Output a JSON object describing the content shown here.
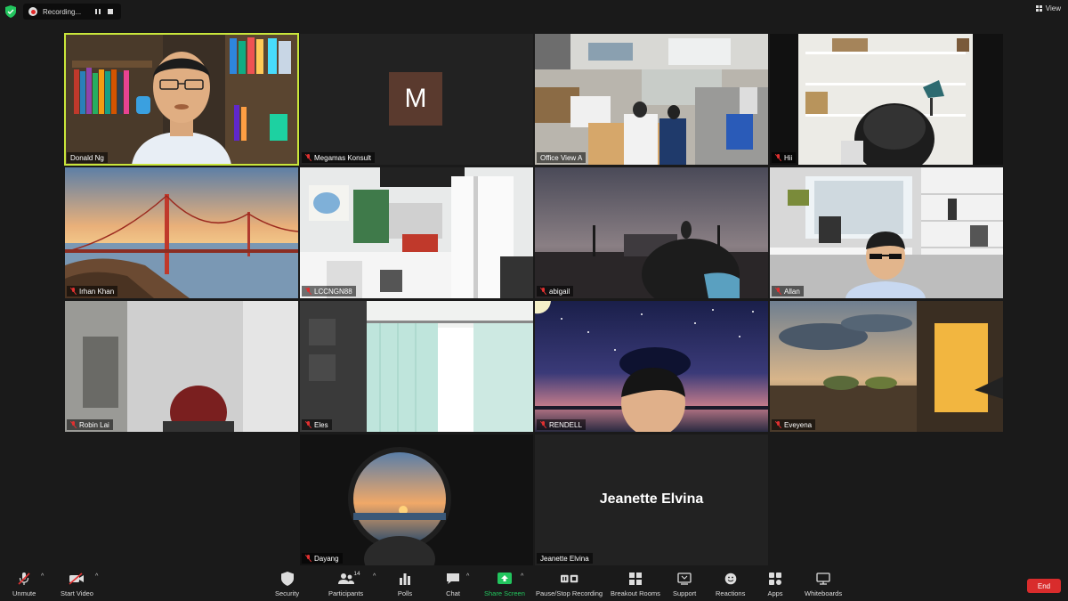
{
  "topbar": {
    "recording_label": "Recording...",
    "view_label": "View"
  },
  "tiles": [
    {
      "name": "Donald Ng",
      "muted": false,
      "active": true,
      "scene": "bookshelf-room"
    },
    {
      "name": "Megamas Konsult",
      "muted": true,
      "avatar_letter": "M",
      "scene": "avatar"
    },
    {
      "name": "Office View A",
      "muted": false,
      "scene": "office"
    },
    {
      "name": "Hii",
      "muted": true,
      "scene": "white-shelf-room"
    },
    {
      "name": "Irhan Khan",
      "muted": true,
      "scene": "golden-gate-bridge"
    },
    {
      "name": "LCCNGN88",
      "muted": true,
      "scene": "office-room"
    },
    {
      "name": "abigail",
      "muted": true,
      "scene": "bridge-dusk"
    },
    {
      "name": "Allan",
      "muted": true,
      "scene": "modern-office"
    },
    {
      "name": "Robin Lai",
      "muted": true,
      "scene": "blurred-room"
    },
    {
      "name": "Eles",
      "muted": true,
      "scene": "curtain-room"
    },
    {
      "name": "RENDELL",
      "muted": true,
      "scene": "starry-night"
    },
    {
      "name": "Eveyena",
      "muted": true,
      "scene": "sunset-window"
    },
    {
      "name": "Dayang",
      "muted": true,
      "scene": "porthole-sunset"
    },
    {
      "name": "Jeanette Elvina",
      "muted": false,
      "big_name": "Jeanette Elvina",
      "scene": "name-only"
    }
  ],
  "toolbar": {
    "unmute": "Unmute",
    "start_video": "Start Video",
    "security": "Security",
    "participants": "Participants",
    "participants_count": "14",
    "polls": "Polls",
    "chat": "Chat",
    "share_screen": "Share Screen",
    "pause_stop_recording": "Pause/Stop Recording",
    "breakout_rooms": "Breakout Rooms",
    "support": "Support",
    "reactions": "Reactions",
    "apps": "Apps",
    "whiteboards": "Whiteboards",
    "end": "End"
  },
  "colors": {
    "background": "#1a1a1a",
    "active_speaker_border": "#c9e63b",
    "muted_red": "#e03030",
    "share_green": "#22c55e",
    "end_red": "#d92c2c"
  }
}
